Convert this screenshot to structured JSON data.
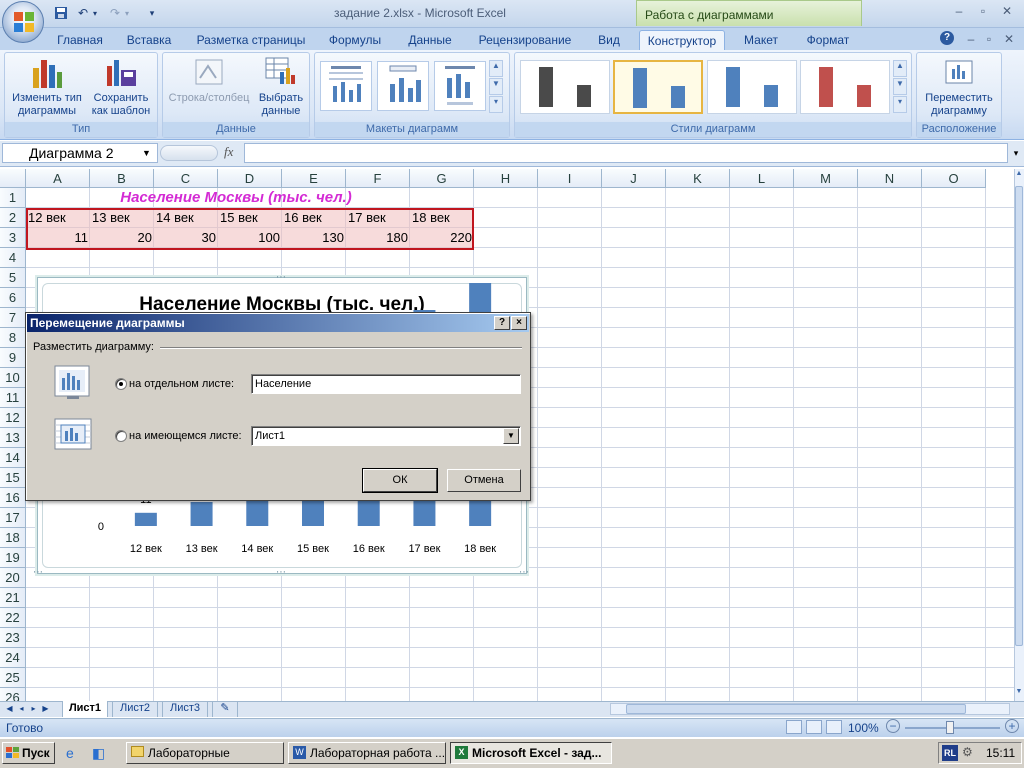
{
  "window": {
    "title": "задание 2.xlsx - Microsoft Excel",
    "context_tab": "Работа с диаграммами"
  },
  "tabs": [
    "Главная",
    "Вставка",
    "Разметка страницы",
    "Формулы",
    "Данные",
    "Рецензирование",
    "Вид",
    "Конструктор",
    "Макет",
    "Формат"
  ],
  "active_tab": "Конструктор",
  "ribbon": {
    "type_group": {
      "label": "Тип",
      "change_type": "Изменить тип\nдиаграммы",
      "save_template": "Сохранить\nкак шаблон"
    },
    "data_group": {
      "label": "Данные",
      "switch_row_col": "Строка/столбец",
      "select_data": "Выбрать\nданные"
    },
    "layouts_group": {
      "label": "Макеты диаграмм"
    },
    "styles_group": {
      "label": "Стили диаграмм",
      "style_colors": [
        "#4a4a4a",
        "#4f81bd",
        "#4f81bd",
        "#c0504d"
      ]
    },
    "location_group": {
      "label": "Расположение",
      "move_chart": "Переместить\nдиаграмму"
    }
  },
  "formula_bar": {
    "name_box": "Диаграмма 2",
    "fx": "fx",
    "value": ""
  },
  "columns": [
    "A",
    "B",
    "C",
    "D",
    "E",
    "F",
    "G",
    "H",
    "I",
    "J",
    "K",
    "L",
    "M",
    "N",
    "O"
  ],
  "rows": [
    "1",
    "2",
    "3",
    "4",
    "5",
    "6",
    "7",
    "8",
    "9",
    "10",
    "11",
    "12",
    "13",
    "14",
    "15",
    "16",
    "17",
    "18",
    "19",
    "20",
    "21",
    "22",
    "23",
    "24",
    "25",
    "26"
  ],
  "sheet": {
    "title": "Население Москвы (тыс. чел.)",
    "headers": [
      "12 век",
      "13 век",
      "14 век",
      "15 век",
      "16 век",
      "17 век",
      "18 век"
    ],
    "values": [
      "11",
      "20",
      "30",
      "100",
      "130",
      "180",
      "220"
    ]
  },
  "chart_data": {
    "type": "bar",
    "title": "Население Москвы (тыс. чел.)",
    "categories": [
      "12 век",
      "13 век",
      "14 век",
      "15 век",
      "16 век",
      "17 век",
      "18 век"
    ],
    "values": [
      11,
      20,
      30,
      100,
      130,
      180,
      220
    ],
    "data_labels": [
      "11"
    ],
    "y_tick_labels": [
      "0"
    ],
    "color": "#4f81bd"
  },
  "dialog": {
    "title": "Перемещение диаграммы",
    "help": "?",
    "close": "×",
    "group_label": "Разместить диаграмму:",
    "option_new_sheet": "на отдельном листе:",
    "new_sheet_value": "Население",
    "option_existing_sheet": "на имеющемся листе:",
    "existing_sheet_value": "Лист1",
    "ok": "ОК",
    "cancel": "Отмена",
    "selected_option": "new_sheet"
  },
  "sheet_tabs": [
    "Лист1",
    "Лист2",
    "Лист3"
  ],
  "status": {
    "ready": "Готово",
    "zoom": "100%"
  },
  "taskbar": {
    "start": "Пуск",
    "tasks": [
      "Лабораторные",
      "Лабораторная работа ...",
      "Microsoft Excel - зад..."
    ],
    "lang": "RL",
    "clock": "15:11"
  }
}
